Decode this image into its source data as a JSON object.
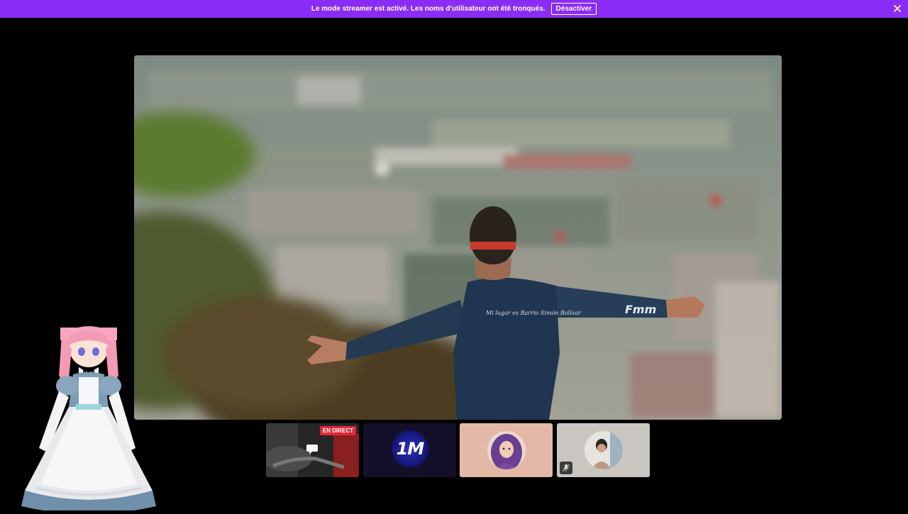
{
  "banner": {
    "message": "Le mode streamer est activé. Les noms d'utilisateur ont été tronqués.",
    "button_label": "Désactiver",
    "close_icon": "close-icon",
    "color": "#8b2cf5"
  },
  "main_video": {
    "shirt_text_back": "Mi lugar es Barrio Simón Bolívar",
    "shirt_text_sleeve": "Fmm"
  },
  "participants": [
    {
      "badge": "EN DIRECT",
      "icon": "chat-bubble-icon"
    },
    {
      "logo_text": "1M"
    },
    {
      "avatar": "avatar-woman-purple-hair"
    },
    {
      "avatar": "avatar-man",
      "status_icon": "microphone-muted-icon"
    }
  ],
  "colors": {
    "background": "#000000",
    "live_badge": "#e2273a"
  }
}
